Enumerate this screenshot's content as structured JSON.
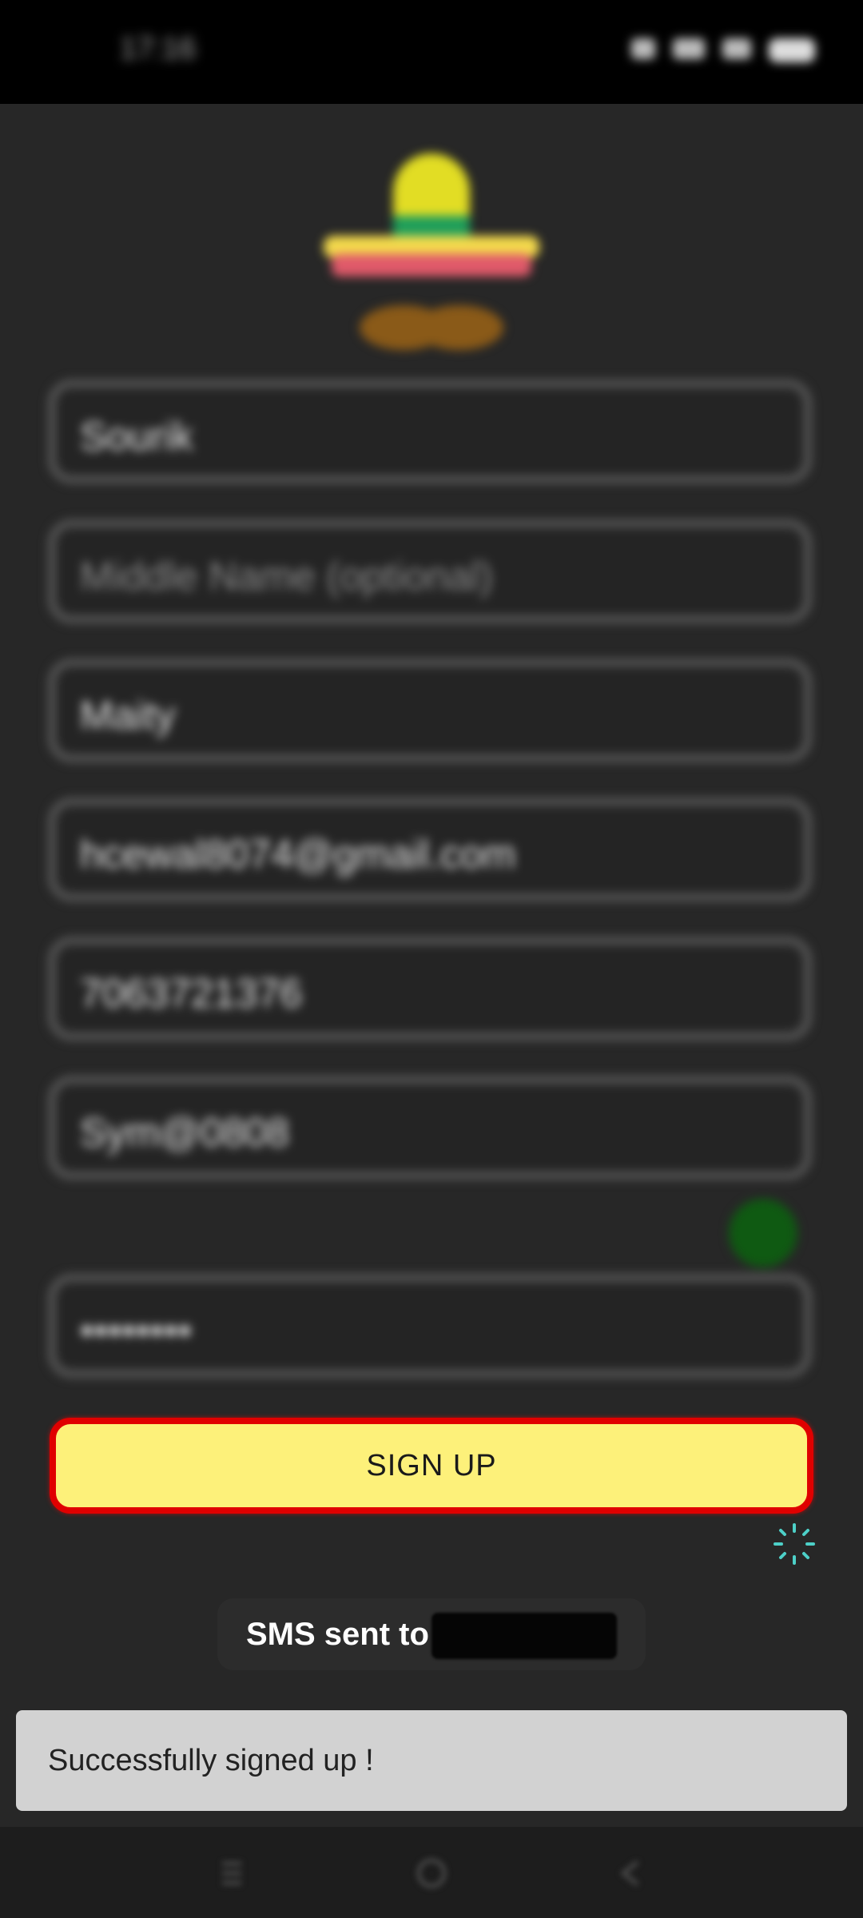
{
  "status_bar": {
    "time": "17:16"
  },
  "logo": {
    "icon": "sombrero-mustache-logo"
  },
  "form": {
    "first_name": "Sourik",
    "middle_name_placeholder": "Middle Name (optional)",
    "last_name": "Maity",
    "email": "hcewal8074@gmail.com",
    "phone": "7063721376",
    "password": "Sym@0808",
    "confirm_password_masked": "••••••••",
    "signup_label": "SIGN UP"
  },
  "toast": {
    "sms_text": "SMS sent to"
  },
  "snackbar": {
    "message": "Successfully signed up !"
  },
  "colors": {
    "signup_bg": "#fdf17a",
    "signup_border": "#e00000",
    "spinner": "#4dd0c8"
  }
}
